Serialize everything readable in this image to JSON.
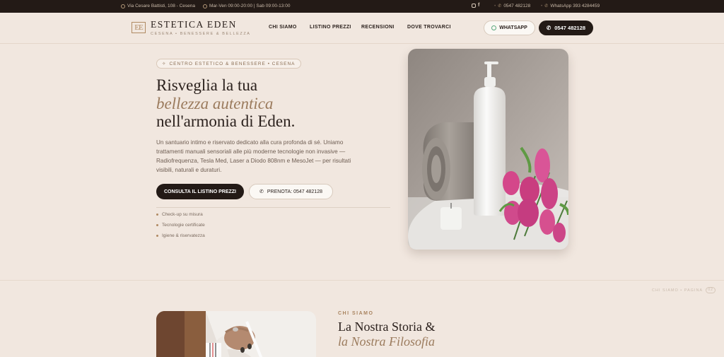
{
  "topbar": {
    "address": "Via Cesare Battisti, 108 - Cesena",
    "hours": "Mar-Ven 09:00-20:00 | Sab 09:00-13:00",
    "phone": "0547 482128",
    "whatsapp": "WhatsApp 393 4284459"
  },
  "header": {
    "logo_mark": "EE",
    "logo_name": "ESTETICA EDEN",
    "logo_sub": "CESENA • BENESSERE & BELLEZZA",
    "nav": [
      "CHI SIAMO",
      "LISTINO PREZZI",
      "RECENSIONI",
      "DOVE TROVARCI"
    ],
    "whatsapp_btn": "WHATSAPP",
    "call_btn": "0547 482128"
  },
  "hero": {
    "badge": "CENTRO ESTETICO & BENESSERE • CESENA",
    "title_line1": "Risveglia la tua",
    "title_line2": "bellezza autentica",
    "title_line3": "nell'armonia di Eden.",
    "lead": "Un santuario intimo e riservato dedicato alla cura profonda di sé. Uniamo trattamenti manuali sensoriali alle più moderne tecnologie non invasive — Radiofrequenza, Tesla Med, Laser a Diodo 808nm e MesoJet — per risultati visibili, naturali e duraturi.",
    "cta_primary": "CONSULTA IL LISTINO PREZZI",
    "cta_secondary": "PRENOTA: 0547 482128",
    "features": [
      "Check-up su misura",
      "Tecnologie certificate",
      "Igiene & riservatezza"
    ]
  },
  "scroll_hint": {
    "text": "CHI SIAMO • PAGINA",
    "num": "02"
  },
  "about": {
    "eyebrow": "CHI SIAMO",
    "title_line1": "La Nostra Storia &",
    "title_line2": "la Nostra Filosofia"
  },
  "colors": {
    "accent": "#9b7b5d",
    "dark": "#231a16",
    "background": "#f1e7df"
  }
}
